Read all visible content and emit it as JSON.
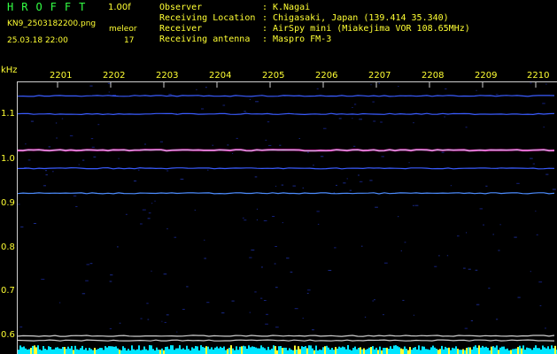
{
  "header": {
    "brand": "HROFFT",
    "version": "1.00f",
    "filename": "KN9_2503182200.png",
    "mode": "meleor",
    "datetime": "25.03.18 22:00",
    "count": "17"
  },
  "meta": [
    {
      "key": "Observer",
      "value": "K.Nagai"
    },
    {
      "key": "Receiving Location",
      "value": "Chigasaki, Japan (139.414 35.340)"
    },
    {
      "key": "Receiver",
      "value": "AirSpy mini (Miakejima VOR 108.65MHz)"
    },
    {
      "key": "Receiving antenna",
      "value": "Maspro FM-3"
    }
  ],
  "meta_separator": ":",
  "axis": {
    "unit": "kHz",
    "y_ticks": [
      "1.1",
      "1.0",
      "0.9",
      "0.8",
      "0.7",
      "0.6"
    ],
    "x_ticks": [
      "2201",
      "2202",
      "2203",
      "2204",
      "2205",
      "2206",
      "2207",
      "2208",
      "2209",
      "2210"
    ]
  },
  "plot": {
    "background": "#000000",
    "y_range_khz": [
      0.58,
      1.18
    ],
    "signal_lines": [
      {
        "freq_khz": 1.15,
        "color": "#3a5cff"
      },
      {
        "freq_khz": 1.11,
        "color": "#3a5cff"
      },
      {
        "freq_khz": 1.03,
        "color": "#ff3ad0"
      },
      {
        "freq_khz": 0.99,
        "color": "#3a5cff"
      },
      {
        "freq_khz": 0.935,
        "color": "#4d8dff"
      },
      {
        "freq_khz": 0.62,
        "color": "#d0d0d0"
      },
      {
        "freq_khz": 0.61,
        "color": "#d0d0d0"
      }
    ],
    "noise_color": "#00e5ff"
  }
}
